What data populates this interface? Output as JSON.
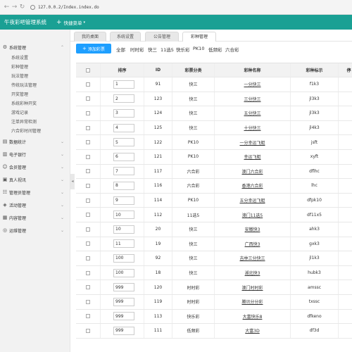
{
  "browser": {
    "url": "127.0.0.2/Index.index.do"
  },
  "header": {
    "app_title": "午夜彩吧管理系统",
    "quick_menu": "快捷菜单"
  },
  "sidebar": {
    "groups": [
      {
        "label": "系统管理",
        "expanded": true,
        "items": [
          "系统设置",
          "彩种管理",
          "玩法管理",
          "传统玩法管理",
          "开奖管理",
          "系统彩种开奖",
          "游戏记录",
          "注单异常检测",
          "六合彩时间管理"
        ]
      },
      {
        "label": "数据统计"
      },
      {
        "label": "电子银行"
      },
      {
        "label": "会员管理"
      },
      {
        "label": "真人视讯"
      },
      {
        "label": "管理员管理"
      },
      {
        "label": "活动管理"
      },
      {
        "label": "内容管理"
      },
      {
        "label": "运维管理"
      }
    ]
  },
  "tabs": [
    "我的桌面",
    "系统设置",
    "公告管理",
    "彩种管理"
  ],
  "toolbar": {
    "add_label": "添加彩票",
    "filters": [
      "全部",
      "时时彩",
      "快三",
      "11选5",
      "快乐彩",
      "PK10",
      "低频彩",
      "六合彩"
    ]
  },
  "table": {
    "columns": [
      "排序",
      "ID",
      "彩票分类",
      "彩种名称",
      "彩种标示",
      "停"
    ],
    "rows": [
      [
        "1",
        "91",
        "快三",
        "一分快三",
        "f1k3"
      ],
      [
        "2",
        "123",
        "快三",
        "三分快三",
        "jl3k3"
      ],
      [
        "3",
        "124",
        "快三",
        "五分快三",
        "jl3k3"
      ],
      [
        "4",
        "125",
        "快三",
        "十分快三",
        "jl4k3"
      ],
      [
        "5",
        "122",
        "PK10",
        "一分幸运飞艇",
        "jsft"
      ],
      [
        "6",
        "121",
        "PK10",
        "幸运飞艇",
        "xyft"
      ],
      [
        "7",
        "117",
        "六合彩",
        "澳门六合彩",
        "dflhc"
      ],
      [
        "8",
        "116",
        "六合彩",
        "香港六合彩",
        "lhc"
      ],
      [
        "9",
        "114",
        "PK10",
        "五分幸运飞艇",
        "dfpk10"
      ],
      [
        "10",
        "112",
        "11选5",
        "澳门11选5",
        "df11x5"
      ],
      [
        "10",
        "20",
        "快三",
        "安徽快3",
        "ahk3"
      ],
      [
        "11",
        "19",
        "快三",
        "广西快3",
        "gxk3"
      ],
      [
        "100",
        "92",
        "快三",
        "吉林三分快三",
        "jl1k3"
      ],
      [
        "100",
        "18",
        "快三",
        "湖北快3",
        "hubk3"
      ],
      [
        "999",
        "120",
        "时时彩",
        "澳门时时彩",
        "amssc"
      ],
      [
        "999",
        "119",
        "时时彩",
        "腾讯分分彩",
        "txssc"
      ],
      [
        "999",
        "113",
        "快乐彩",
        "大富快乐8",
        "dfkeno"
      ],
      [
        "999",
        "111",
        "低频彩",
        "大富3D",
        "df3d"
      ]
    ]
  }
}
